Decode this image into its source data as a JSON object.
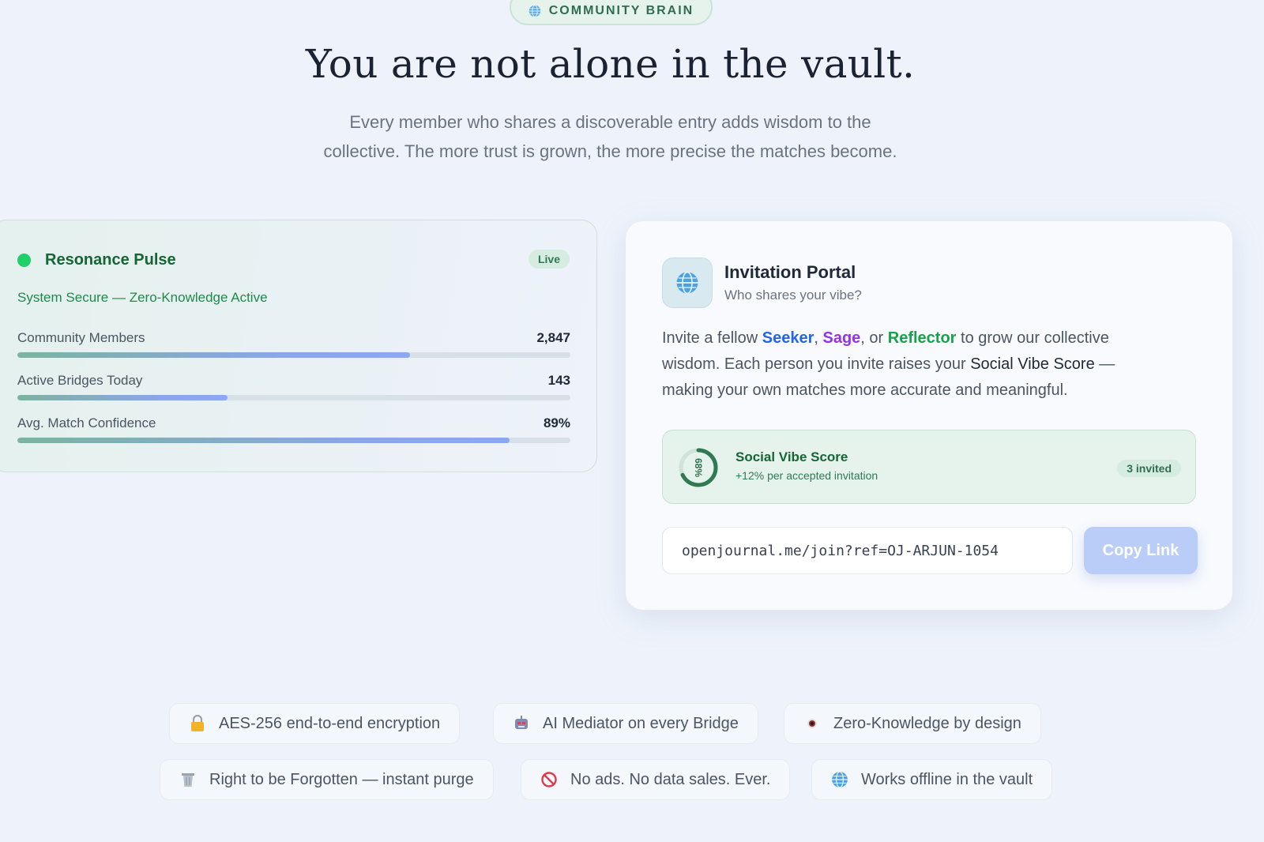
{
  "header": {
    "badge": "COMMUNITY BRAIN",
    "title": "You are not alone in the vault.",
    "subtitle_line1": "Every member who shares a discoverable entry adds wisdom to the",
    "subtitle_line2": "collective. The more trust is grown, the more precise the matches become."
  },
  "pulse": {
    "title": "Resonance Pulse",
    "live": "Live",
    "status": "System Secure — Zero-Knowledge Active",
    "metrics": [
      {
        "label": "Community Members",
        "value": "2,847",
        "fill": 0.71
      },
      {
        "label": "Active Bridges Today",
        "value": "143",
        "fill": 0.38
      },
      {
        "label": "Avg. Match Confidence",
        "value": "89%",
        "fill": 0.89
      }
    ]
  },
  "invite": {
    "title": "Invitation Portal",
    "subtitle": "Who shares your vibe?",
    "text_1": "Invite a fellow ",
    "role_seeker": "Seeker",
    "sep_1": ", ",
    "role_sage": "Sage",
    "sep_2": ", or ",
    "role_reflector": "Reflector",
    "text_2": " to grow our collective wisdom. Each person you invite raises your ",
    "score_name": "Social Vibe Score",
    "text_3": " — making your own matches more accurate and meaningful.",
    "vibe_title": "Social Vibe Score",
    "vibe_sub": "+12% per accepted invitation",
    "vibe_percent": "68%",
    "vibe_value": 0.68,
    "invited": "3 invited",
    "link": "openjournal.me/join?ref=OJ-ARJUN-1054",
    "copy_label": "Copy Link"
  },
  "features": [
    {
      "icon": "lock-icon",
      "label": "AES-256 end-to-end encryption"
    },
    {
      "icon": "robot-icon",
      "label": "AI Mediator on every Bridge"
    },
    {
      "icon": "eye-icon",
      "label": "Zero-Knowledge by design"
    },
    {
      "icon": "trash-icon",
      "label": "Right to be Forgotten — instant purge"
    },
    {
      "icon": "no-entry-icon",
      "label": "No ads. No data sales. Ever."
    },
    {
      "icon": "globe-icon",
      "label": "Works offline in the vault"
    }
  ],
  "colors": {
    "accent_green": "#166534",
    "seeker": "#2563eb",
    "sage": "#9333ea",
    "reflector": "#16a34a",
    "copy_button": "#b9cdf8"
  }
}
